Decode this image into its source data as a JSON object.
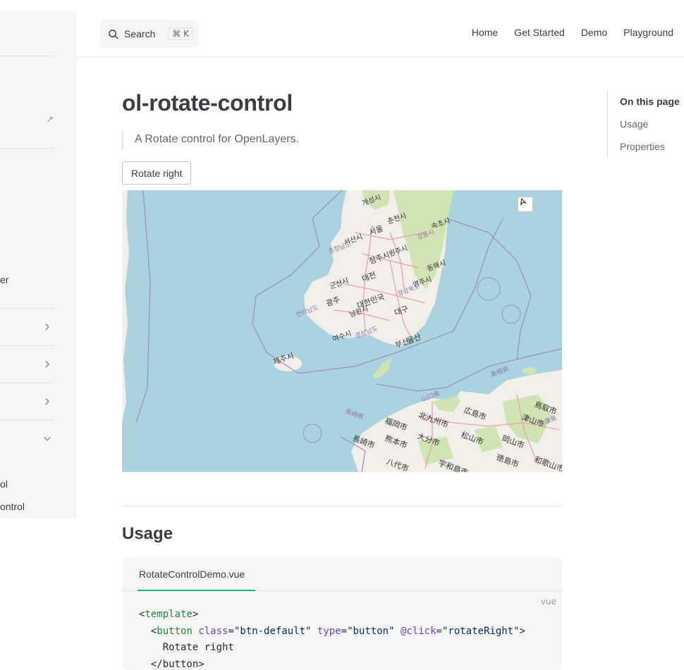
{
  "search": {
    "label": "Search",
    "shortcut": "⌘ K"
  },
  "nav": [
    "Home",
    "Get Started",
    "Demo",
    "Playground"
  ],
  "sidebar": {
    "fragment_er": "er",
    "fragment_ol": "ol",
    "fragment_ontrol": "ontrol"
  },
  "page": {
    "title": "ol-rotate-control",
    "description": "A Rotate control for OpenLayers.",
    "button_label": "Rotate right"
  },
  "map": {
    "labels": [
      "서울",
      "청주시",
      "대전",
      "대한민국",
      "대구",
      "광주",
      "울산",
      "부산",
      "제주시",
      "개성시",
      "춘천시",
      "속초시",
      "강릉시",
      "원주시",
      "동해시",
      "영주시",
      "서산시",
      "군산시",
      "포항시",
      "경상북도",
      "충청남도",
      "전라남도",
      "남원시",
      "여수시",
      "경상남도",
      "福岡市",
      "北九州市",
      "広島市",
      "松山市",
      "岡山市",
      "大分市",
      "熊本市",
      "長崎市",
      "八代市",
      "山口県",
      "島根県",
      "鳥取市",
      "津山市",
      "兵庫県",
      "徳島市",
      "和歌山市",
      "長崎県",
      "宇和島市"
    ],
    "colors": {
      "water": "#aad3df",
      "land": "#f2efe9",
      "green": "#cfe3b3",
      "road": "#e8a2a8",
      "border": "#9b8fb5"
    }
  },
  "usage": {
    "heading": "Usage",
    "file_tab": "RotateControlDemo.vue",
    "lang": "vue",
    "code": {
      "l1_open": "<",
      "l1_tag": "template",
      "l1_close": ">",
      "l2_indent": "  ",
      "l2_open": "<",
      "l2_tag": "button",
      "l2_attr1": "class",
      "l2_eq1": "=",
      "l2_val1": "\"btn-default\"",
      "l2_attr2": "type",
      "l2_eq2": "=",
      "l2_val2": "\"button\"",
      "l2_attr3": "@click",
      "l2_eq3": "=",
      "l2_val3": "\"rotateRight\"",
      "l2_close": ">",
      "l3": "    Rotate right",
      "l4": "  </button>"
    }
  },
  "aside": {
    "title": "On this page",
    "links": [
      "Usage",
      "Properties"
    ]
  }
}
